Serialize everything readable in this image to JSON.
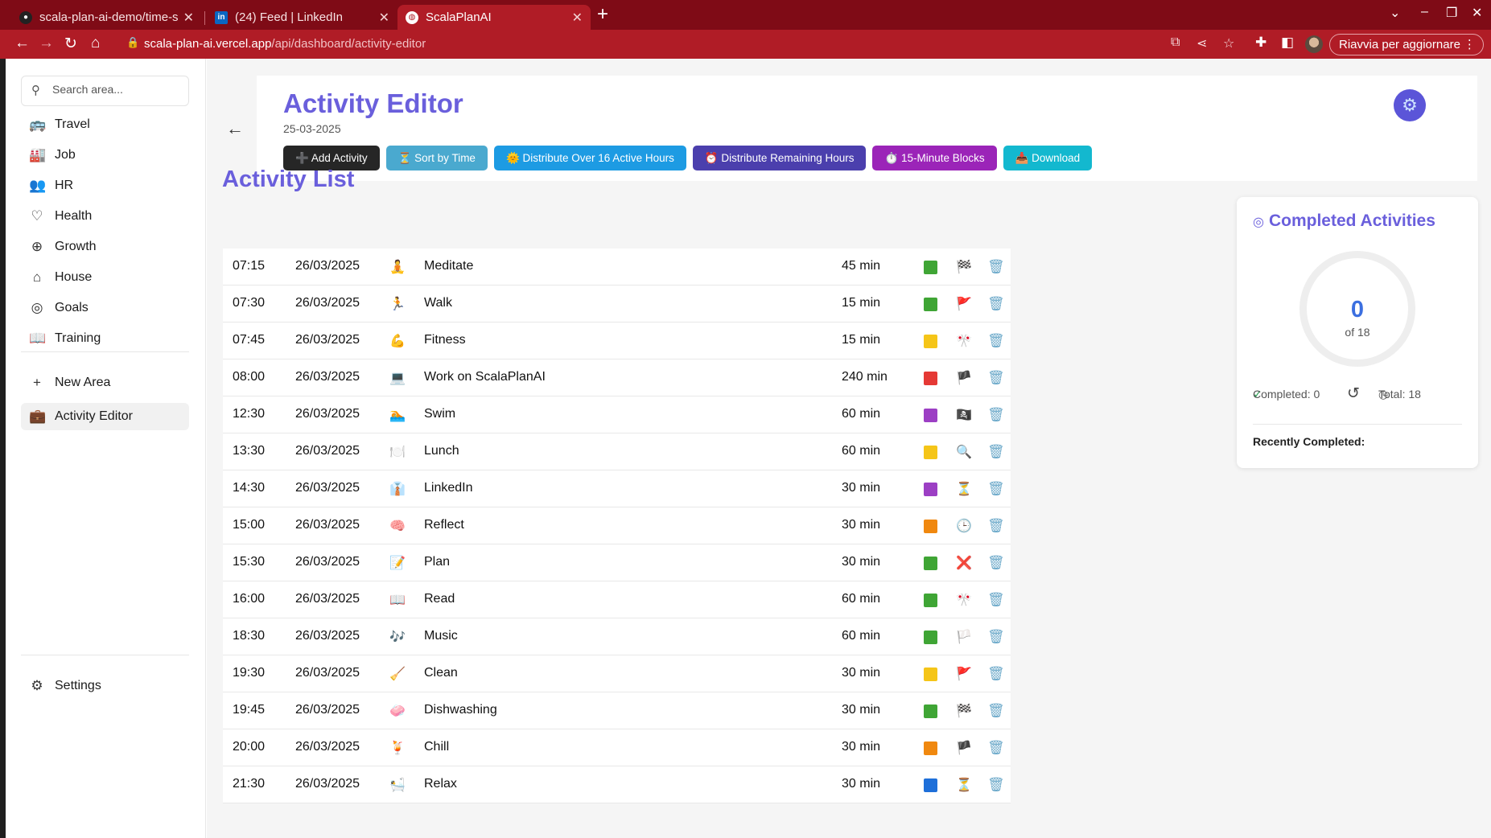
{
  "browser": {
    "tabs": [
      {
        "title": "scala-plan-ai-demo/time-s",
        "icon": "github-icon"
      },
      {
        "title": "(24) Feed | LinkedIn",
        "icon": "linkedin-icon"
      },
      {
        "title": "ScalaPlanAI",
        "icon": "globe-icon"
      }
    ],
    "url_host": "scala-plan-ai.vercel.app",
    "url_path": "/api/dashboard/activity-editor",
    "update_label": "Riavvia per aggiornare"
  },
  "sidebar": {
    "search_placeholder": "Search area...",
    "items": [
      {
        "label": "Travel",
        "icon": "bus-icon"
      },
      {
        "label": "Job",
        "icon": "factory-icon"
      },
      {
        "label": "HR",
        "icon": "users-icon"
      },
      {
        "label": "Health",
        "icon": "heart-icon"
      },
      {
        "label": "Growth",
        "icon": "globe-icon"
      },
      {
        "label": "House",
        "icon": "house-icon"
      },
      {
        "label": "Goals",
        "icon": "target-icon"
      },
      {
        "label": "Training",
        "icon": "book-icon"
      }
    ],
    "new_area": "New Area",
    "activity_editor": "Activity Editor",
    "settings": "Settings"
  },
  "header": {
    "title": "Activity Editor",
    "date": "25-03-2025",
    "actions": [
      "➕ Add Activity",
      "⏳ Sort by Time",
      "🌞 Distribute Over 16 Active Hours",
      "⏰ Distribute Remaining Hours",
      "⏱️ 15-Minute Blocks",
      "📥 Download"
    ]
  },
  "activity_list": {
    "title": "Activity List",
    "rows": [
      {
        "time": "07:15",
        "date": "26/03/2025",
        "emoji": "🧘",
        "name": "Meditate",
        "duration": "45 min",
        "color": "#3fa535",
        "flag": "🏁"
      },
      {
        "time": "07:30",
        "date": "26/03/2025",
        "emoji": "🏃",
        "name": "Walk",
        "duration": "15 min",
        "color": "#3fa535",
        "flag": "🚩"
      },
      {
        "time": "07:45",
        "date": "26/03/2025",
        "emoji": "💪",
        "name": "Fitness",
        "duration": "15 min",
        "color": "#f5c518",
        "flag": "🎌"
      },
      {
        "time": "08:00",
        "date": "26/03/2025",
        "emoji": "💻",
        "name": "Work on ScalaPlanAI",
        "duration": "240 min",
        "color": "#e53935",
        "flag": "🏴"
      },
      {
        "time": "12:30",
        "date": "26/03/2025",
        "emoji": "🏊",
        "name": "Swim",
        "duration": "60 min",
        "color": "#9c3fc4",
        "flag": "🏴‍☠️"
      },
      {
        "time": "13:30",
        "date": "26/03/2025",
        "emoji": "🍽️",
        "name": "Lunch",
        "duration": "60 min",
        "color": "#f5c518",
        "flag": "🔍"
      },
      {
        "time": "14:30",
        "date": "26/03/2025",
        "emoji": "👔",
        "name": "LinkedIn",
        "duration": "30 min",
        "color": "#9c3fc4",
        "flag": "⏳"
      },
      {
        "time": "15:00",
        "date": "26/03/2025",
        "emoji": "🧠",
        "name": "Reflect",
        "duration": "30 min",
        "color": "#f0880f",
        "flag": "🕒"
      },
      {
        "time": "15:30",
        "date": "26/03/2025",
        "emoji": "📝",
        "name": "Plan",
        "duration": "30 min",
        "color": "#3fa535",
        "flag": "❌"
      },
      {
        "time": "16:00",
        "date": "26/03/2025",
        "emoji": "📖",
        "name": "Read",
        "duration": "60 min",
        "color": "#3fa535",
        "flag": "🎌"
      },
      {
        "time": "18:30",
        "date": "26/03/2025",
        "emoji": "🎶",
        "name": "Music",
        "duration": "60 min",
        "color": "#3fa535",
        "flag": "🏳️"
      },
      {
        "time": "19:30",
        "date": "26/03/2025",
        "emoji": "🧹",
        "name": "Clean",
        "duration": "30 min",
        "color": "#f5c518",
        "flag": "🚩"
      },
      {
        "time": "19:45",
        "date": "26/03/2025",
        "emoji": "🧼",
        "name": "Dishwashing",
        "duration": "30 min",
        "color": "#3fa535",
        "flag": "🏁"
      },
      {
        "time": "20:00",
        "date": "26/03/2025",
        "emoji": "🍹",
        "name": "Chill",
        "duration": "30 min",
        "color": "#f0880f",
        "flag": "🏴"
      },
      {
        "time": "21:30",
        "date": "26/03/2025",
        "emoji": "🛀",
        "name": "Relax",
        "duration": "30 min",
        "color": "#1e6fd9",
        "flag": "⏳"
      }
    ]
  },
  "completed": {
    "title": "Completed Activities",
    "count": "0",
    "of_total": "of 18",
    "completed_label": "Completed: 0",
    "total_label": "Total: 18",
    "recent_label": "Recently Completed:"
  }
}
